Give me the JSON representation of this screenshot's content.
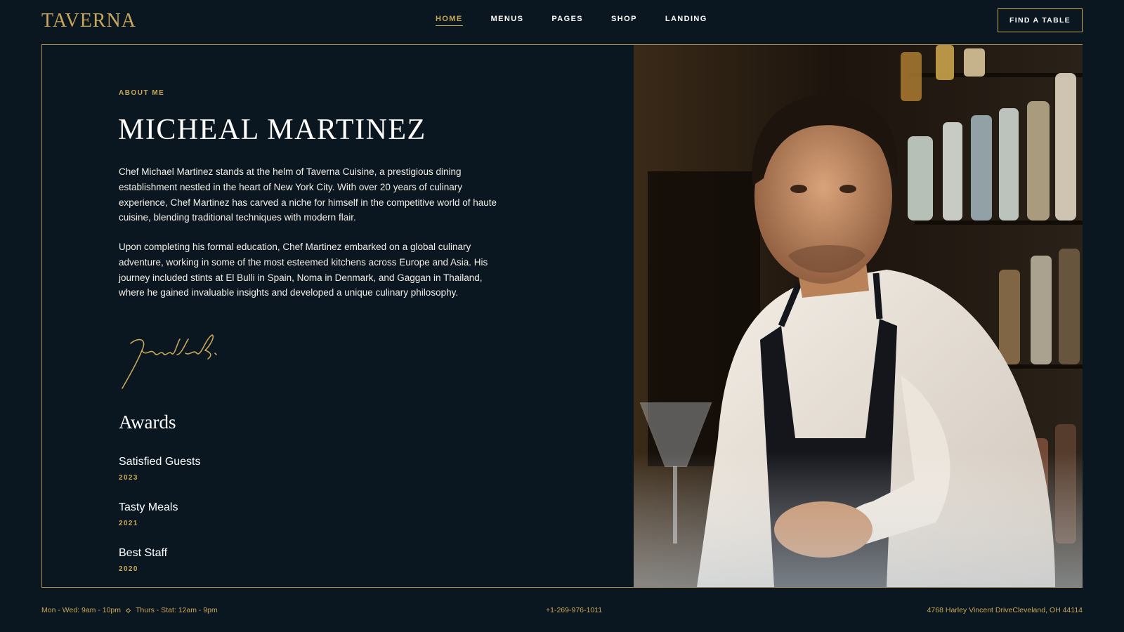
{
  "header": {
    "logo": "TAVERNA",
    "nav": [
      "HOME",
      "MENUS",
      "PAGES",
      "SHOP",
      "LANDING"
    ],
    "active_nav": "HOME",
    "cta": "FIND A TABLE"
  },
  "about": {
    "eyebrow": "ABOUT ME",
    "name": "MICHEAL MARTINEZ",
    "paragraphs": [
      "Chef Michael Martinez stands at the helm of Taverna Cuisine, a prestigious dining establishment nestled in the heart of New York City. With over 20 years of culinary experience, Chef Martinez has carved a niche for himself in the competitive world of haute cuisine, blending traditional techniques with modern flair.",
      "Upon completing his formal education, Chef Martinez embarked on a global culinary adventure, working in some of the most esteemed kitchens across Europe and Asia. His journey included stints at El Bulli in Spain, Noma in Denmark, and Gaggan in Thailand, where he gained invaluable insights and developed a unique culinary philosophy."
    ]
  },
  "awards": {
    "title": "Awards",
    "items": [
      {
        "name": "Satisfied Guests",
        "year": "2023"
      },
      {
        "name": "Tasty Meals",
        "year": "2021"
      },
      {
        "name": "Best Staff",
        "year": "2020"
      }
    ]
  },
  "footer": {
    "hours_1": "Mon - Wed: 9am - 10pm",
    "hours_2": "Thurs - Stat: 12am - 9pm",
    "phone": "+1-269-976-1011",
    "address": "4768 Harley Vincent DriveCleveland, OH 44114"
  },
  "colors": {
    "background": "#0b1720",
    "accent": "#c8a75a",
    "text": "#ffffff"
  }
}
